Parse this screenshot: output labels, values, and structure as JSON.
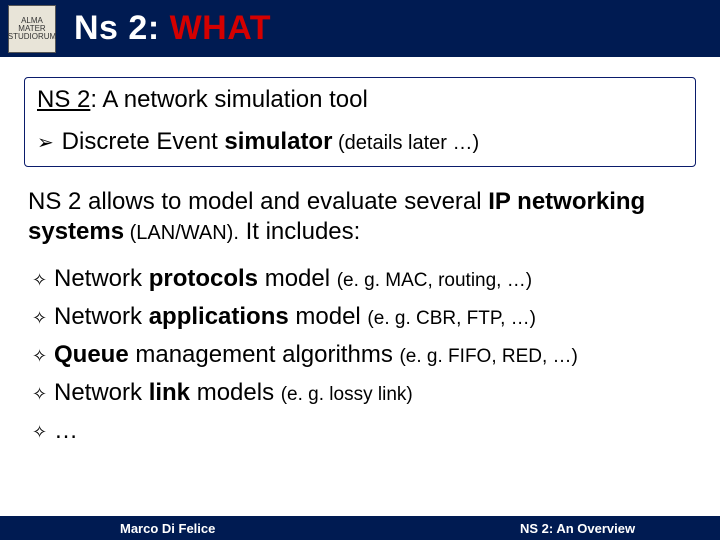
{
  "header": {
    "seal_text": "ALMA MATER STUDIORUM",
    "title_part1": "Ns 2: ",
    "title_part2": "WHAT"
  },
  "box": {
    "subtitle_prefix": "NS 2",
    "subtitle_rest": ": A network simulation tool",
    "bullet_glyph": "➢",
    "bullet_a": "Discrete Event ",
    "bullet_b": "simulator",
    "bullet_c": " (details later …)"
  },
  "para": {
    "a": "NS 2 allows to model and evaluate several ",
    "b": "IP networking systems",
    "c": " (LAN/WAN).",
    "d": " It includes:"
  },
  "list": {
    "glyph": "✧",
    "items": [
      {
        "a": "Network ",
        "b": "protocols",
        "c": " model ",
        "eg": "(e. g. MAC, routing, …)"
      },
      {
        "a": "Network ",
        "b": "applications",
        "c": " model ",
        "eg": "(e. g. CBR, FTP, …)"
      },
      {
        "a": "",
        "b": "Queue",
        "c": " management algorithms ",
        "eg": "(e. g. FIFO, RED, …)"
      },
      {
        "a": "Network ",
        "b": "link",
        "c": " models ",
        "eg": "(e. g. lossy link)"
      },
      {
        "a": "…",
        "b": "",
        "c": "",
        "eg": ""
      }
    ]
  },
  "footer": {
    "author": "Marco Di Felice",
    "right": "NS 2: An Overview"
  }
}
